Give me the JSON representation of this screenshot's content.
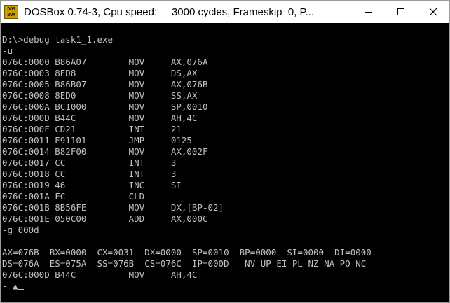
{
  "window": {
    "icon_text_top": "DOS",
    "icon_text_bottom": "BOX",
    "title": "DOSBox 0.74-3, Cpu speed:     3000 cycles, Frameskip  0, P...",
    "buttons": {
      "minimize": "minimize-icon",
      "maximize": "maximize-icon",
      "close": "close-icon"
    }
  },
  "console": {
    "lines": [
      "",
      "D:\\>debug task1_1.exe",
      "-u",
      "076C:0000 B86A07        MOV     AX,076A",
      "076C:0003 8ED8          MOV     DS,AX",
      "076C:0005 B86B07        MOV     AX,076B",
      "076C:0008 8ED0          MOV     SS,AX",
      "076C:000A BC1000        MOV     SP,0010",
      "076C:000D B44C          MOV     AH,4C",
      "076C:000F CD21          INT     21",
      "076C:0011 E91101        JMP     0125",
      "076C:0014 B82F00        MOV     AX,002F",
      "076C:0017 CC            INT     3",
      "076C:0018 CC            INT     3",
      "076C:0019 46            INC     SI",
      "076C:001A FC            CLD",
      "076C:001B 8B56FE        MOV     DX,[BP-02]",
      "076C:001E 050C00        ADD     AX,000C",
      "-g 000d",
      "",
      "AX=076B  BX=0000  CX=0031  DX=0000  SP=0010  BP=0000  SI=0000  DI=0000",
      "DS=076A  ES=075A  SS=076B  CS=076C  IP=000D   NV UP EI PL NZ NA PO NC",
      "076C:000D B44C          MOV     AH,4C",
      "- ▲"
    ],
    "text_color": "#c0c0c0",
    "background": "#000000"
  }
}
